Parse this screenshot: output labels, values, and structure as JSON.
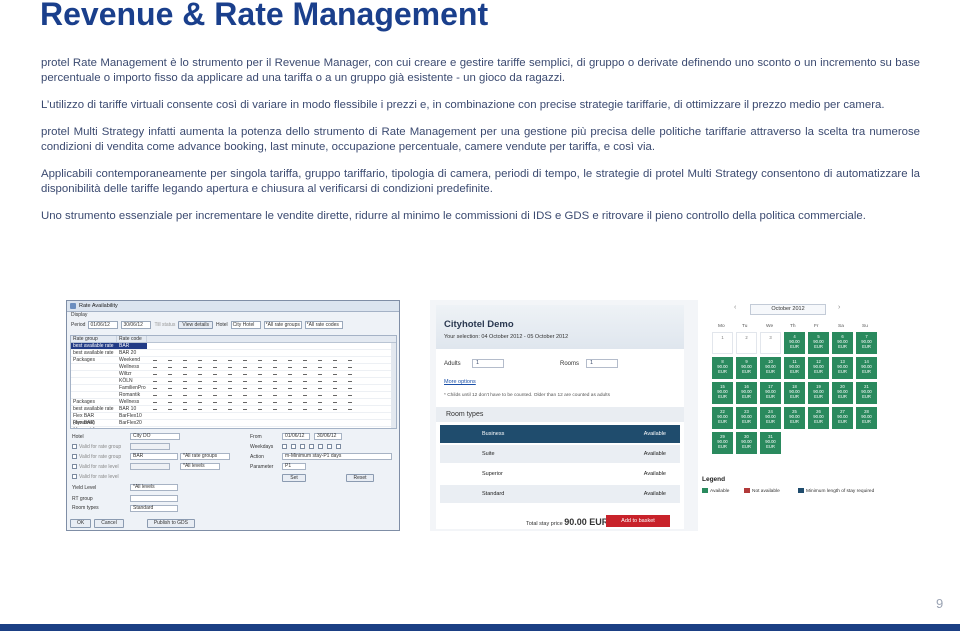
{
  "title": "Revenue & Rate Management",
  "paragraphs": [
    "protel Rate Management è lo strumento per il Revenue Manager, con cui creare e gestire tariffe semplici, di gruppo o derivate definendo uno sconto o un incremento su base percentuale o importo fisso da applicare ad una tariffa o a un gruppo già esistente - un gioco da ragazzi.",
    "L’utilizzo di tariffe virtuali consente così di variare in modo flessibile i prezzi e, in combinazione con precise strategie tariffarie, di ottimizzare il prezzo medio per camera.",
    "protel Multi Strategy infatti aumenta la potenza dello strumento di Rate Management per una gestione più precisa delle politiche tariffarie attraverso la scelta tra numerose condizioni di vendita come advance booking, last minute, occupazione percentuale, camere vendute per tariffa, e così via.",
    "Applicabili contemporaneamente per singola tariffa, gruppo tariffario, tipologia di camera, periodi di tempo, le strategie di protel Multi Strategy consentono di automatizzare la disponibilità delle tariffe legando apertura e chiusura al verificarsi di condizioni predefinite.",
    "Uno strumento essenziale per incrementare le vendite dirette, ridurre al minimo le commissioni di IDS e GDS e ritrovare il pieno controllo della politica commerciale."
  ],
  "rate_window": {
    "title": "Rate Availability",
    "display": "Display",
    "period_label": "Period",
    "period_from": "01/06/12",
    "period_to": "30/06/12",
    "until_label": "Till status",
    "view_details": "View details",
    "hotel_label": "Hotel",
    "hotel_value": "City Hotel",
    "rate_groups_value": "*All rate groups",
    "rate_codes_value": "*All rate codes",
    "grid_headers": [
      "Rate group",
      "Rate code",
      "Rate code"
    ],
    "grid_rows": [
      {
        "group": "best available rate",
        "code": "BAR"
      },
      {
        "group": "best available rate",
        "code": "BAR 20"
      },
      {
        "group": "Packages",
        "code": "Weekend"
      },
      {
        "group": "",
        "code": "Wellness"
      },
      {
        "group": "",
        "code": "Wiltzr"
      },
      {
        "group": "",
        "code": "KÖLN"
      },
      {
        "group": "",
        "code": "FamilienPro"
      },
      {
        "group": "",
        "code": "Romantik"
      },
      {
        "group": "Packages",
        "code": "Wellness"
      },
      {
        "group": "best available rate",
        "code": "BAR 10"
      },
      {
        "group": "Flex BAR (dynamic)",
        "code": "BarFlex10"
      },
      {
        "group": "Flex BAR (dynamic)",
        "code": "BarFlex20"
      }
    ],
    "form": {
      "hotel_label": "Hotel",
      "hotel_value": "City DO",
      "from_label": "From",
      "from_value": "01/06/12",
      "to_value": "30/06/12",
      "weekdays_label": "Weekdays",
      "action_label": "Action",
      "action_value": "m-Minimum stay-P1 days",
      "parameter_label": "Parameter",
      "parameter_value": "P1",
      "set_label": "Set",
      "reset_label": "Reset",
      "yield_level_label": "Yield Level",
      "yield_level_value": "*All levels",
      "rt_group_label": "RT group",
      "room_type_label": "Room types",
      "room_type_value": "Standard",
      "rate_code_value": "BAR",
      "all_rate_groups": "*All rate groups",
      "all_levels": "*All levels",
      "checkbox_labels": [
        "Valid for rate group",
        "Valid for rate group",
        "Valid for rate level",
        "Valid for rate level"
      ]
    },
    "ok_label": "OK",
    "cancel_label": "Cancel",
    "publish_label": "Publish to GDS"
  },
  "booking": {
    "hotel_name": "Cityhotel Demo",
    "selection": "Your selection: 04 October 2012 - 05 October 2012",
    "adults_label": "Adults",
    "adults_value": "1",
    "rooms_label": "Rooms",
    "rooms_value": "1",
    "more_options": "More options",
    "children_note": "* Childs until 12 don't have to be counted. Older than 12 are counted as adults",
    "room_types_label": "Room types",
    "rooms": [
      {
        "name": "Business",
        "status": "Available"
      },
      {
        "name": "Suite",
        "status": "Available"
      },
      {
        "name": "Superior",
        "status": "Available"
      },
      {
        "name": "Standard",
        "status": "Available"
      }
    ],
    "total_label": "Total stay price",
    "total_value": "90.00 EUR",
    "basket_label": "Add to basket"
  },
  "calendar": {
    "month": "October 2012",
    "weekdays": [
      "Mo",
      "Tu",
      "We",
      "Th",
      "Fr",
      "Sa",
      "Su"
    ],
    "rows": [
      [
        "1",
        "2",
        "3",
        "4",
        "5",
        "6",
        "7"
      ],
      [
        "8",
        "9",
        "10",
        "11",
        "12",
        "13",
        "14"
      ],
      [
        "15",
        "16",
        "17",
        "18",
        "19",
        "20",
        "21"
      ],
      [
        "22",
        "23",
        "24",
        "25",
        "26",
        "27",
        "28"
      ],
      [
        "29",
        "30",
        "31",
        "",
        "",
        "",
        ""
      ]
    ],
    "price": "90.00",
    "currency": "EUR",
    "legend_title": "Legend",
    "legend": [
      "Available",
      "Not available",
      "Minimum length of stay required"
    ],
    "colors": {
      "available": "#2a8a5e",
      "not_available": "#b23a3a",
      "min_stay": "#1f4c6d"
    }
  },
  "page_number": "9"
}
